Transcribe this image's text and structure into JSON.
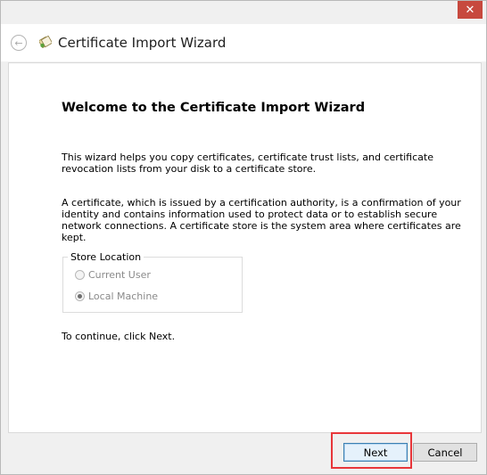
{
  "window": {
    "close_glyph": "✕",
    "back_glyph": "←",
    "title": "Certificate Import Wizard"
  },
  "content": {
    "heading": "Welcome to the Certificate Import Wizard",
    "paragraph1": "This wizard helps you copy certificates, certificate trust lists, and certificate revocation lists from your disk to a certificate store.",
    "paragraph2": "A certificate, which is issued by a certification authority, is a confirmation of your identity and contains information used to protect data or to establish secure network connections. A certificate store is the system area where certificates are kept.",
    "store_location": {
      "label": "Store Location",
      "options": [
        {
          "label": "Current User",
          "selected": false,
          "enabled": false
        },
        {
          "label": "Local Machine",
          "selected": true,
          "enabled": false
        }
      ]
    },
    "continue_text": "To continue, click Next."
  },
  "buttons": {
    "next": "Next",
    "cancel": "Cancel"
  },
  "colors": {
    "close_button": "#c7493e",
    "highlight": "#e8363a",
    "default_button_border": "#3c7fb1"
  }
}
